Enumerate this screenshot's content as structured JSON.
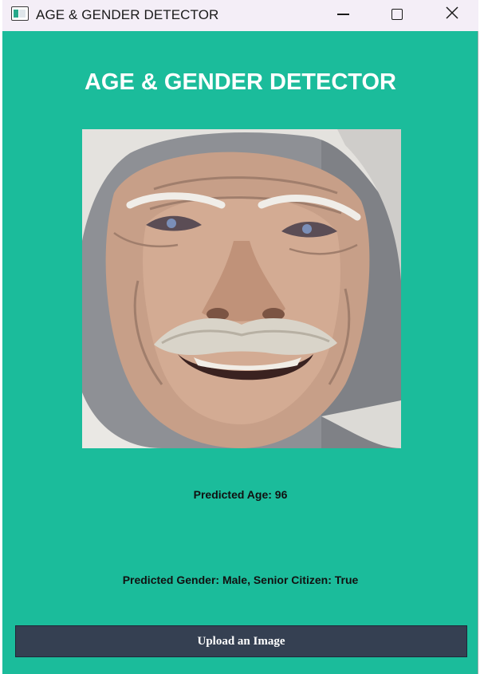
{
  "window": {
    "title": "AGE & GENDER DETECTOR",
    "controls": {
      "minimize_icon": "minimize-icon",
      "maximize_icon": "maximize-icon",
      "close_icon": "close-icon",
      "close_glyph": "✕"
    }
  },
  "main": {
    "heading": "AGE & GENDER DETECTOR",
    "image_subject": "elderly-man-face-photo",
    "predicted_age": "Predicted Age: 96",
    "predicted_gender": "Predicted Gender: Male, Senior Citizen: True",
    "upload_button": "Upload an Image"
  },
  "colors": {
    "background": "#1bbc9b",
    "titlebar": "#f4eef7",
    "button": "#354052",
    "heading_text": "#ffffff"
  }
}
